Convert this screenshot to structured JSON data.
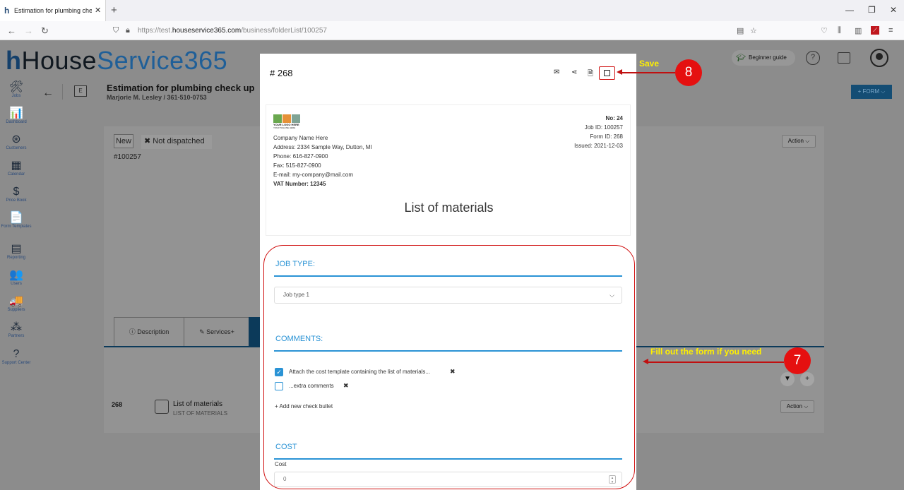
{
  "browser": {
    "tab_title": "Estimation for plumbing check up",
    "tab_close": "✕",
    "new_tab": "+",
    "url_prefix": "https://test.",
    "url_domain": "houseservice365.com",
    "url_path": "/business/folderList/100257",
    "win_min": "—",
    "win_restore": "❐",
    "win_close": "✕"
  },
  "app": {
    "logo_h": "h",
    "logo_house": "House",
    "logo_service": "Service365",
    "sidebar": [
      {
        "icon": "🛠",
        "label": "Jobs"
      },
      {
        "icon": "📊",
        "label": "Dashboard"
      },
      {
        "icon": "⊛",
        "label": "Customers"
      },
      {
        "icon": "▦",
        "label": "Calendar"
      },
      {
        "icon": "$",
        "label": "Price Book"
      },
      {
        "icon": "📄",
        "label": "Form Templates"
      },
      {
        "icon": "▤",
        "label": "Reporting"
      },
      {
        "icon": "👥",
        "label": "Users"
      },
      {
        "icon": "🚚",
        "label": "Suppliers"
      },
      {
        "icon": "⁂",
        "label": "Partners"
      },
      {
        "icon": "?",
        "label": "Support Center"
      }
    ],
    "header": {
      "back": "←",
      "e_label": "E",
      "title": "Estimation for plumbing check up",
      "subtitle": "Marjorie M. Lesley / 361-510-0753"
    },
    "beginner_guide": "Beginner guide",
    "help": "?",
    "form_button": "+ FORM ⌵",
    "job": {
      "status_new": "New",
      "not_dispatched": "✖ Not dispatched",
      "job_number": "#100257",
      "action": "Action ⌵"
    },
    "tabs": {
      "description": "ⓘ Description",
      "services": "✎ Services+"
    },
    "filter": "▼",
    "add": "+",
    "form_row": {
      "number": "268",
      "title": "List of materials",
      "subtitle": "LIST OF MATERIALS",
      "action": "Action ⌵"
    }
  },
  "modal": {
    "form_number": "# 268",
    "icons": {
      "email": "✉",
      "share": "⋖",
      "pdf": "🗎"
    },
    "document": {
      "logo_caption": "YOUR LOGO HERE",
      "logo_tagline": "YOUR TAGLINE HERE",
      "company": "Company Name Here",
      "address": "Address: 2334 Sample Way, Dutton, MI",
      "phone": "Phone: 616-827-0900",
      "fax": "Fax: 515-827-0900",
      "email": "E-mail: my-company@mail.com",
      "vat": "VAT Number: 12345",
      "no": "No: 24",
      "job_id": "Job ID: 100257",
      "form_id": "Form ID: 268",
      "issued": "Issued: 2021-12-03",
      "heading": "List of materials"
    },
    "job_type": {
      "title": "JOB TYPE:",
      "selected": "Job type 1",
      "chevron": "⌵"
    },
    "comments": {
      "title": "COMMENTS:",
      "items": [
        {
          "text": "Attach the cost template containing the list of materials...",
          "checked": true
        },
        {
          "text": "...extra comments",
          "checked": false
        }
      ],
      "remove": "✖",
      "add": "+ Add new check bullet"
    },
    "cost": {
      "title": "COST",
      "label": "Cost",
      "value": "0"
    }
  },
  "annotations": {
    "save_label": "Save",
    "step8": "8",
    "fill_label": "Fill out the form if you need",
    "step7": "7"
  }
}
